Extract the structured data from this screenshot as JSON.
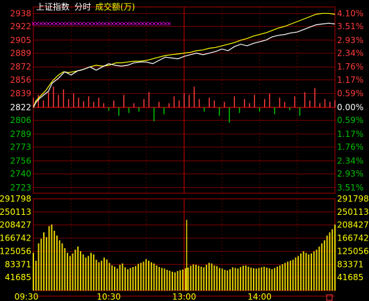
{
  "header": {
    "index_name": "上证指数",
    "mode": "分时",
    "volume_label": "成交额(万)"
  },
  "colors": {
    "background": "#000000",
    "frame_red": "#b00000",
    "up_red": "#ff3b3b",
    "down_green": "#00c000",
    "price_white": "#ffffff",
    "avg_yellow": "#ffff00",
    "volume_yellow": "#e6d200",
    "bar_magenta": "#ff00ff",
    "neutral_white": "#ffffff"
  },
  "chart_data": {
    "type": "line",
    "price_axis": {
      "ticks": [
        "2938",
        "2922",
        "2905",
        "2889",
        "2872",
        "2856",
        "2839",
        "2822",
        "2806",
        "2789",
        "2773",
        "2756",
        "2740",
        "2723"
      ],
      "tick_values": [
        2938,
        2922,
        2905,
        2889,
        2872,
        2856,
        2839,
        2822,
        2806,
        2789,
        2773,
        2756,
        2740,
        2723
      ],
      "base_value": 2822,
      "pct_ticks": [
        "4.10%",
        "3.51%",
        "2.93%",
        "2.34%",
        "1.76%",
        "1.17%",
        "0.59%",
        "0.00%",
        "0.59%",
        "1.17%",
        "1.76%",
        "2.34%",
        "2.93%",
        "3.51%"
      ],
      "ylim": [
        2716,
        2946
      ]
    },
    "volume_axis": {
      "ticks": [
        "291798",
        "250113",
        "208427",
        "166742",
        "125056",
        "83371",
        "41685"
      ],
      "tick_values": [
        291798,
        250113,
        208427,
        166742,
        125056,
        83371,
        41685
      ],
      "ylim": [
        0,
        291798
      ]
    },
    "x_axis": {
      "ticks": [
        "09:30",
        "10:30",
        "13:00",
        "14:00"
      ],
      "tick_minutes": [
        0,
        60,
        120,
        180
      ],
      "range_minutes": [
        0,
        240
      ]
    },
    "series": [
      {
        "name": "",
        "points": [
          [
            0,
            2822
          ],
          [
            2,
            2830
          ],
          [
            5,
            2835
          ],
          [
            10,
            2843
          ],
          [
            14,
            2852
          ],
          [
            16,
            2856
          ],
          [
            20,
            2862
          ],
          [
            24,
            2866
          ],
          [
            28,
            2865
          ],
          [
            32,
            2866
          ],
          [
            38,
            2868
          ],
          [
            45,
            2872
          ],
          [
            50,
            2874
          ],
          [
            55,
            2873
          ],
          [
            60,
            2874
          ],
          [
            66,
            2877
          ],
          [
            70,
            2877
          ],
          [
            75,
            2878
          ],
          [
            80,
            2879
          ],
          [
            85,
            2879
          ],
          [
            90,
            2880
          ],
          [
            95,
            2882
          ],
          [
            100,
            2884
          ],
          [
            105,
            2886
          ],
          [
            110,
            2887
          ],
          [
            115,
            2888
          ],
          [
            120,
            2889
          ],
          [
            125,
            2890
          ],
          [
            130,
            2892
          ],
          [
            135,
            2893
          ],
          [
            140,
            2895
          ],
          [
            145,
            2896
          ],
          [
            150,
            2898
          ],
          [
            155,
            2900
          ],
          [
            160,
            2902
          ],
          [
            165,
            2905
          ],
          [
            170,
            2907
          ],
          [
            175,
            2910
          ],
          [
            180,
            2912
          ],
          [
            185,
            2914
          ],
          [
            190,
            2917
          ],
          [
            195,
            2920
          ],
          [
            200,
            2922
          ],
          [
            205,
            2925
          ],
          [
            210,
            2928
          ],
          [
            215,
            2931
          ],
          [
            220,
            2934
          ],
          [
            225,
            2937
          ],
          [
            230,
            2938
          ],
          [
            235,
            2938
          ],
          [
            240,
            2937
          ]
        ]
      },
      {
        "name": "",
        "points": [
          [
            0,
            2822
          ],
          [
            2,
            2828
          ],
          [
            5,
            2833
          ],
          [
            8,
            2837
          ],
          [
            12,
            2842
          ],
          [
            15,
            2852
          ],
          [
            20,
            2858
          ],
          [
            25,
            2866
          ],
          [
            30,
            2862
          ],
          [
            35,
            2867
          ],
          [
            40,
            2869
          ],
          [
            45,
            2872
          ],
          [
            50,
            2868
          ],
          [
            55,
            2872
          ],
          [
            60,
            2876
          ],
          [
            65,
            2874
          ],
          [
            70,
            2873
          ],
          [
            75,
            2874
          ],
          [
            80,
            2877
          ],
          [
            85,
            2878
          ],
          [
            90,
            2878
          ],
          [
            95,
            2876
          ],
          [
            100,
            2880
          ],
          [
            105,
            2884
          ],
          [
            110,
            2883
          ],
          [
            115,
            2882
          ],
          [
            120,
            2885
          ],
          [
            125,
            2887
          ],
          [
            130,
            2889
          ],
          [
            135,
            2887
          ],
          [
            140,
            2889
          ],
          [
            145,
            2891
          ],
          [
            150,
            2894
          ],
          [
            155,
            2892
          ],
          [
            160,
            2897
          ],
          [
            165,
            2900
          ],
          [
            170,
            2898
          ],
          [
            175,
            2901
          ],
          [
            180,
            2903
          ],
          [
            185,
            2905
          ],
          [
            190,
            2909
          ],
          [
            195,
            2911
          ],
          [
            200,
            2912
          ],
          [
            205,
            2914
          ],
          [
            210,
            2915
          ],
          [
            215,
            2918
          ],
          [
            220,
            2921
          ],
          [
            225,
            2924
          ],
          [
            230,
            2925
          ],
          [
            235,
            2926
          ],
          [
            240,
            2925
          ]
        ]
      }
    ],
    "breadth_bars": [
      {
        "t": 0,
        "v": 14
      },
      {
        "t": 4,
        "v": 18
      },
      {
        "t": 8,
        "v": 10
      },
      {
        "t": 12,
        "v": 22
      },
      {
        "t": 16,
        "v": 30
      },
      {
        "t": 20,
        "v": 18
      },
      {
        "t": 24,
        "v": 26
      },
      {
        "t": 28,
        "v": 12
      },
      {
        "t": 32,
        "v": 20
      },
      {
        "t": 36,
        "v": 14
      },
      {
        "t": 40,
        "v": 9
      },
      {
        "t": 44,
        "v": 16
      },
      {
        "t": 48,
        "v": 8
      },
      {
        "t": 52,
        "v": 14
      },
      {
        "t": 56,
        "v": 6
      },
      {
        "t": 60,
        "v": -5
      },
      {
        "t": 64,
        "v": 10
      },
      {
        "t": 68,
        "v": -12
      },
      {
        "t": 72,
        "v": 18
      },
      {
        "t": 76,
        "v": -8
      },
      {
        "t": 80,
        "v": 6
      },
      {
        "t": 84,
        "v": -6
      },
      {
        "t": 88,
        "v": 12
      },
      {
        "t": 92,
        "v": 22
      },
      {
        "t": 96,
        "v": -20
      },
      {
        "t": 100,
        "v": 8
      },
      {
        "t": 104,
        "v": -10
      },
      {
        "t": 108,
        "v": 6
      },
      {
        "t": 112,
        "v": 16
      },
      {
        "t": 116,
        "v": 10
      },
      {
        "t": 120,
        "v": 20
      },
      {
        "t": 124,
        "v": 18
      },
      {
        "t": 128,
        "v": 30
      },
      {
        "t": 132,
        "v": 12
      },
      {
        "t": 136,
        "v": -6
      },
      {
        "t": 140,
        "v": 14
      },
      {
        "t": 144,
        "v": 10
      },
      {
        "t": 148,
        "v": -12
      },
      {
        "t": 152,
        "v": 8
      },
      {
        "t": 156,
        "v": -22
      },
      {
        "t": 160,
        "v": 16
      },
      {
        "t": 164,
        "v": -8
      },
      {
        "t": 168,
        "v": 12
      },
      {
        "t": 172,
        "v": 6
      },
      {
        "t": 176,
        "v": 18
      },
      {
        "t": 180,
        "v": -6
      },
      {
        "t": 184,
        "v": 12
      },
      {
        "t": 188,
        "v": 20
      },
      {
        "t": 192,
        "v": -10
      },
      {
        "t": 196,
        "v": 14
      },
      {
        "t": 200,
        "v": 8
      },
      {
        "t": 204,
        "v": -4
      },
      {
        "t": 208,
        "v": 16
      },
      {
        "t": 212,
        "v": -12
      },
      {
        "t": 216,
        "v": 22
      },
      {
        "t": 220,
        "v": 10
      },
      {
        "t": 224,
        "v": 28
      },
      {
        "t": 228,
        "v": 6
      },
      {
        "t": 232,
        "v": 12
      },
      {
        "t": 236,
        "v": 8
      },
      {
        "t": 240,
        "v": 10
      }
    ],
    "volume": [
      120000,
      95000,
      150000,
      165000,
      185000,
      170000,
      205000,
      210000,
      190000,
      175000,
      160000,
      150000,
      135000,
      120000,
      110000,
      118000,
      130000,
      140000,
      125000,
      115000,
      105000,
      110000,
      120000,
      115000,
      98000,
      90000,
      95000,
      105000,
      99000,
      88000,
      80000,
      76000,
      70000,
      82000,
      86000,
      74000,
      68000,
      72000,
      75000,
      78000,
      85000,
      88000,
      92000,
      100000,
      95000,
      90000,
      86000,
      80000,
      75000,
      72000,
      70000,
      66000,
      63000,
      60000,
      58000,
      62000,
      65000,
      67000,
      71000,
      73000,
      79000,
      83000,
      82000,
      79000,
      76000,
      74000,
      82000,
      88000,
      86000,
      80000,
      78000,
      72000,
      70000,
      66000,
      64000,
      68000,
      74000,
      72000,
      70000,
      75000,
      79000,
      80000,
      76000,
      73000,
      71000,
      70000,
      72000,
      74000,
      76000,
      73000,
      71000,
      68000,
      72000,
      76000,
      80000,
      84000,
      88000,
      92000,
      95000,
      98000,
      105000,
      110000,
      118000,
      125000,
      120000,
      115000,
      118000,
      125000,
      130000,
      140000,
      150000,
      160000,
      175000,
      185000,
      195000,
      210000
    ],
    "magenta_band": {
      "from_min": 0,
      "to_min": 110
    }
  }
}
